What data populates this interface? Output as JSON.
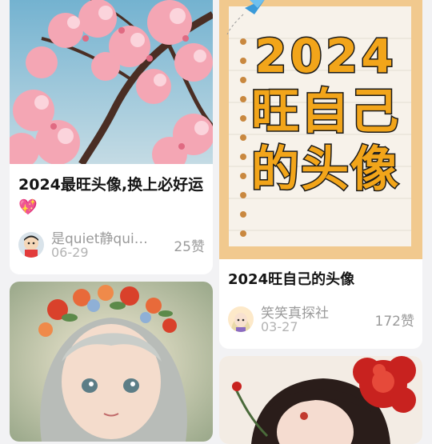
{
  "cards": [
    {
      "title": "2024最旺头像,换上必好运💖",
      "author": "是quiet静qui…",
      "date": "06-29",
      "likes": "25赞",
      "image": "cherry-blossom-illustration"
    },
    {
      "title": "2024旺自己的头像",
      "author": "笑笑真探社",
      "date": "03-27",
      "likes": "172赞",
      "image": "notebook-poster",
      "poster": {
        "line1": "2024",
        "line2": "旺自己",
        "line3": "的头像"
      }
    },
    {
      "title": "",
      "image": "girl-with-flower-crown-illustration"
    },
    {
      "title": "",
      "image": "girl-with-red-peony-illustration"
    }
  ],
  "colors": {
    "page_bg": "#f2f2f4",
    "card_bg": "#ffffff",
    "poster_text": "#f2a51a"
  }
}
